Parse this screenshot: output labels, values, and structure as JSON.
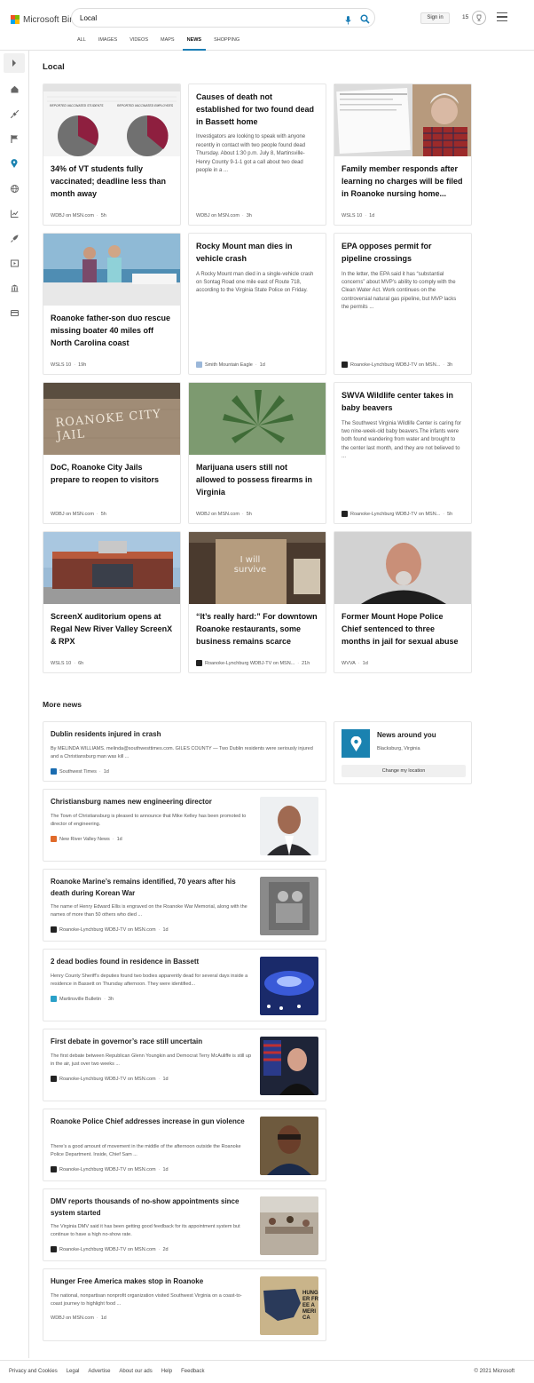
{
  "header": {
    "logo_text": "Microsoft Bing",
    "search_value": "Local",
    "signin_label": "Sign in",
    "points": "15",
    "tabs": [
      {
        "label": "ALL",
        "active": false
      },
      {
        "label": "IMAGES",
        "active": false
      },
      {
        "label": "VIDEOS",
        "active": false
      },
      {
        "label": "MAPS",
        "active": false
      },
      {
        "label": "NEWS",
        "active": true
      },
      {
        "label": "SHOPPING",
        "active": false
      }
    ]
  },
  "sidebar": {
    "icons": [
      "expand-icon",
      "home-icon",
      "satellite-icon",
      "flag-icon",
      "location-icon",
      "globe-icon",
      "chart-icon",
      "rocket-icon",
      "video-icon",
      "museum-icon",
      "card-icon"
    ]
  },
  "local": {
    "title": "Local",
    "cards": [
      {
        "title": "34% of VT students fully vaccinated; deadline less than month away",
        "source": "WDBJ on MSN.com",
        "time": "5h",
        "chart_left": "REPORTED VACCINATED STUDENTS",
        "chart_right": "REPORTED VACCINATED EMPLOYEES"
      },
      {
        "title": "Causes of death not established for two found dead in Bassett home",
        "desc": "Investigators are looking to speak with anyone recently in contact with two people found dead Thursday. About 1:30 p.m. July 8, Martinsville-Henry County 9-1-1 got a call about two dead people in a ...",
        "source": "WDBJ on MSN.com",
        "time": "3h"
      },
      {
        "title": "Family member responds after learning no charges will be filed in Roanoke nursing home...",
        "source": "WSLS 10",
        "time": "1d"
      },
      {
        "title": "Roanoke father-son duo rescue missing boater 40 miles off North Carolina coast",
        "source": "WSLS 10",
        "time": "19h"
      },
      {
        "title": "Rocky Mount man dies in vehicle crash",
        "desc": "A Rocky Mount man died in a single-vehicle crash on Sontag Road one mile east of Route 718, according to the Virginia State Police on Friday.",
        "source": "Smith Mountain Eagle",
        "time": "1d"
      },
      {
        "title": "EPA opposes permit for pipeline crossings",
        "desc": "In the letter, the EPA said it has “substantial concerns” about MVP’s ability to comply with the Clean Water Act. Work continues on the controversial natural gas pipeline, but MVP lacks the permits ...",
        "source": "Roanoke-Lynchburg WDBJ-TV on MSN...",
        "time": "3h"
      },
      {
        "title": "DoC, Roanoke City Jails prepare to reopen to visitors",
        "source": "WDBJ on MSN.com",
        "time": "5h",
        "img_text": "ROANOKE CITY JAIL"
      },
      {
        "title": "Marijuana users still not allowed to possess firearms in Virginia",
        "source": "WDBJ on MSN.com",
        "time": "5h"
      },
      {
        "title": "SWVA Wildlife center takes in baby beavers",
        "desc": "The Southwest Virginia Wildlife Center is caring for two nine-week-old baby beavers.The infants were both found wandering from water and brought to the center last month, and they are not believed to ...",
        "source": "Roanoke-Lynchburg WDBJ-TV on MSN...",
        "time": "5h"
      },
      {
        "title": "ScreenX auditorium opens at Regal New River Valley ScreenX & RPX",
        "source": "WSLS 10",
        "time": "6h"
      },
      {
        "title": "“It’s really hard:” For downtown Roanoke restaurants, some business remains scarce",
        "source": "Roanoke-Lynchburg WDBJ-TV on MSN...",
        "time": "21h",
        "img_text": "I will survive"
      },
      {
        "title": "Former Mount Hope Police Chief sentenced to three months in jail for sexual abuse",
        "source": "WVVA",
        "time": "1d"
      }
    ]
  },
  "more_news": {
    "title": "More news",
    "items": [
      {
        "title": "Dublin residents injured in crash",
        "desc": "By MELINDA WILLIAMS. melinda@southwesttimes.com. GILES COUNTY — Two Dublin residents were seriously injured and a Christiansburg man was kill ...",
        "source": "Southwest Times",
        "time": "1d"
      },
      {
        "title": "Christiansburg names new engineering director",
        "desc": "The Town of Christiansburg is pleased to announce that Mike Kelley has been promoted to director of engineering.",
        "source": "New River Valley News",
        "time": "1d"
      },
      {
        "title": "Roanoke Marine’s remains identified, 70 years after his death during Korean War",
        "desc": "The name of Henry Edward Ellis is engraved on the Roanoke War Memorial, along with the names of more than 50 others who died ...",
        "source": "Roanoke-Lynchburg WDBJ-TV on MSN.com",
        "time": "1d"
      },
      {
        "title": "2 dead bodies found in residence in Bassett",
        "desc": "Henry County Sheriff’s deputies found two bodies apparently dead for several days inside a residence in Bassett on Thursday afternoon. They were identified...",
        "source": "Martinsville Bulletin",
        "time": "3h"
      },
      {
        "title": "First debate in governor’s race still uncertain",
        "desc": "The first debate between Republican Glenn Youngkin and Democrat Terry McAuliffe is still up in the air, just over two weeks ...",
        "source": "Roanoke-Lynchburg WDBJ-TV on MSN.com",
        "time": "1d"
      },
      {
        "title": "Roanoke Police Chief addresses increase in gun violence",
        "desc": "There’s a good amount of movement in the middle of the afternoon outside the Roanoke Police Department. Inside, Chief Sam ...",
        "source": "Roanoke-Lynchburg WDBJ-TV on MSN.com",
        "time": "1d"
      },
      {
        "title": "DMV reports thousands of no-show appointments since system started",
        "desc": "The Virginia DMV said it has been getting good feedback for its appointment system but continue to have a high no-show rate.",
        "source": "Roanoke-Lynchburg WDBJ-TV on MSN.com",
        "time": "2d"
      },
      {
        "title": "Hunger Free America makes stop in Roanoke",
        "desc": "The national, nonpartisan nonprofit organization visited Southwest Virginia on a coast-to-coast journey to highlight food ...",
        "source": "WDBJ on MSN.com",
        "time": "1d",
        "img_text": "HUNGER FREE AMERICA"
      }
    ]
  },
  "around_you": {
    "title": "News around you",
    "location": "Blacksburg, Virginia",
    "button": "Change my location"
  },
  "footer": {
    "links": [
      "Privacy and Cookies",
      "Legal",
      "Advertise",
      "About our ads",
      "Help",
      "Feedback"
    ],
    "copyright": "© 2021 Microsoft"
  },
  "colors": {
    "accent": "#1a7db5",
    "pin_bg": "#1a82b0"
  }
}
